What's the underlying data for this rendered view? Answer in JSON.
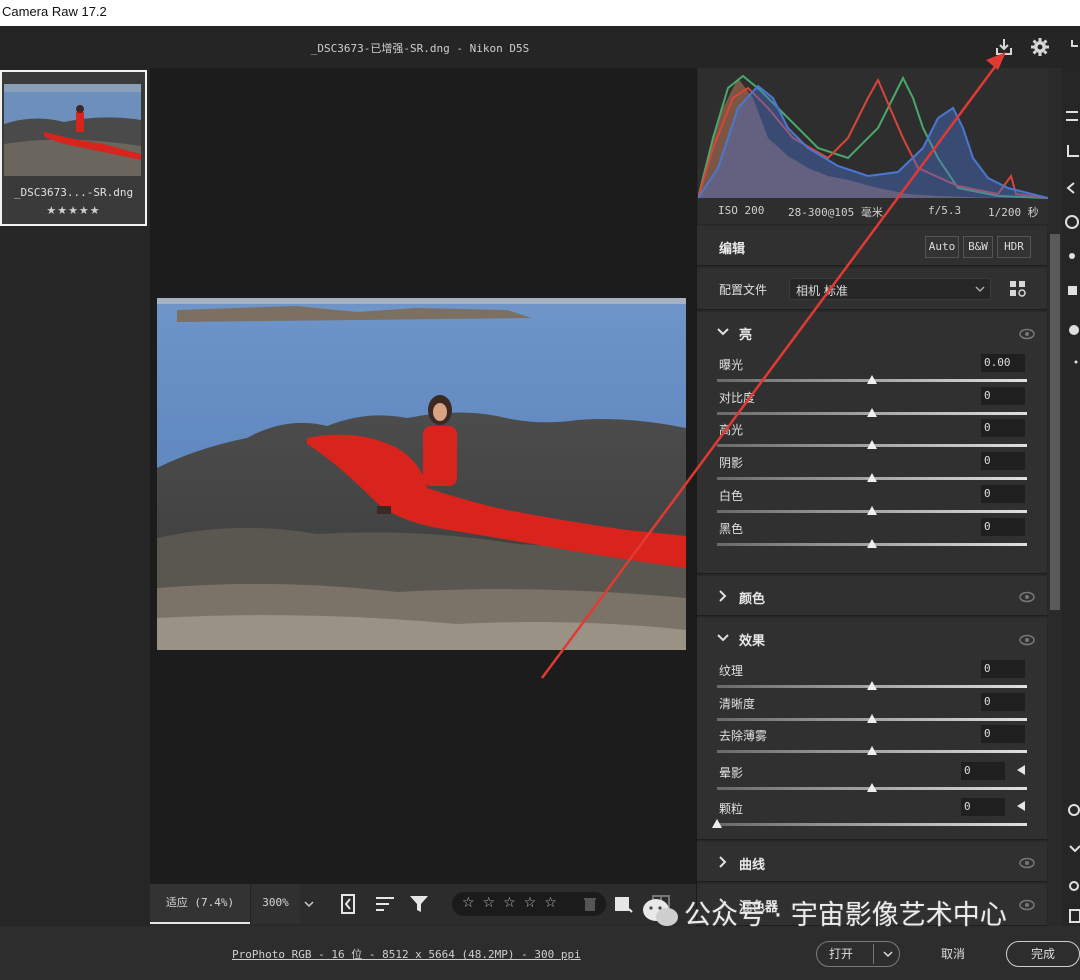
{
  "window": {
    "app_title": "Camera Raw 17.2"
  },
  "header": {
    "file_title": "_DSC3673-已增强-SR.dng -  Nikon D5S"
  },
  "filmstrip": {
    "thumb_name": "_DSC3673...-SR.dng",
    "thumb_stars": "★★★★★"
  },
  "histogram": {
    "iso": "ISO 200",
    "lens": "28-300@105 毫米",
    "aperture": "f/5.3",
    "shutter": "1/200 秒"
  },
  "edit": {
    "title": "编辑",
    "modes": [
      "Auto",
      "B&W",
      "HDR"
    ],
    "profile_label": "配置文件",
    "profile_value": "相机 标准",
    "light": {
      "title": "亮",
      "sliders": [
        {
          "label": "曝光",
          "value": "0.00",
          "pos": 0.5
        },
        {
          "label": "对比度",
          "value": "0",
          "pos": 0.5
        },
        {
          "label": "高光",
          "value": "0",
          "pos": 0.5
        },
        {
          "label": "阴影",
          "value": "0",
          "pos": 0.5
        },
        {
          "label": "白色",
          "value": "0",
          "pos": 0.5
        },
        {
          "label": "黑色",
          "value": "0",
          "pos": 0.5
        }
      ]
    },
    "color": {
      "title": "颜色"
    },
    "effects": {
      "title": "效果",
      "sliders": [
        {
          "label": "纹理",
          "value": "0",
          "pos": 0.5
        },
        {
          "label": "清晰度",
          "value": "0",
          "pos": 0.5
        },
        {
          "label": "去除薄雾",
          "value": "0",
          "pos": 0.5
        },
        {
          "label": "晕影",
          "value": "0",
          "pos": 0.5
        },
        {
          "label": "颗粒",
          "value": "0",
          "pos": 0.0
        }
      ]
    },
    "curve": {
      "title": "曲线"
    },
    "mixer": {
      "title": "混色器"
    }
  },
  "bottom_toolbar": {
    "zoom_fit": "适应 (7.4%)",
    "zoom_300": "300%",
    "stars": "☆☆☆☆☆"
  },
  "footer": {
    "info": "ProPhoto RGB - 16 位 - 8512 x 5664 (48.2MP) - 300 ppi",
    "open": "打开",
    "cancel": "取消",
    "done": "完成"
  },
  "watermark": {
    "text": "公众号 · 宇宙影像艺术中心"
  },
  "colors": {
    "panel": "#282828",
    "viewer": "#1c1c1c",
    "arrow": "#e03a32",
    "dress_red": "#d8241c"
  }
}
